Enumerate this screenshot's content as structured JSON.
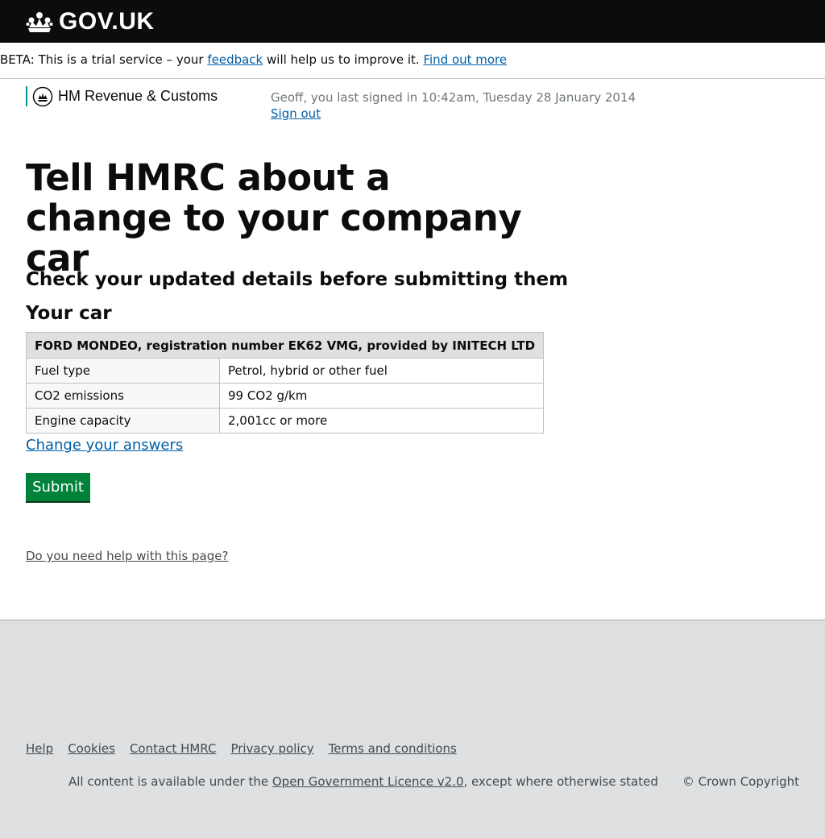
{
  "header": {
    "logo_text": "GOV.UK",
    "logo_icon": "crown-icon"
  },
  "beta_banner": {
    "text_before": "BETA: This is a trial service – your ",
    "feedback_link": "feedback",
    "text_middle": " will help us to improve it. ",
    "find_out_link": "Find out more"
  },
  "department": {
    "name": "HM Revenue & Customs",
    "icon": "crest-icon",
    "accent_color": "#009390"
  },
  "session": {
    "signed_in_text": "Geoff, you last signed in 10:42am, Tuesday 28 January 2014",
    "sign_out": "Sign out"
  },
  "main": {
    "title": "Tell HMRC about a change to your company car",
    "subtitle": "Check your updated details before submitting them",
    "section_heading": "Your car",
    "table": {
      "caption": "FORD MONDEO, registration number EK62 VMG, provided by INITECH LTD",
      "rows": [
        {
          "label": "Fuel type",
          "value": "Petrol, hybrid or other fuel"
        },
        {
          "label": "CO2 emissions",
          "value": "99 CO2 g/km"
        },
        {
          "label": "Engine capacity",
          "value": "2,001cc or more"
        }
      ]
    },
    "change_link": "Change your answers",
    "submit_label": "Submit",
    "help_link": "Do you need help with this page?"
  },
  "footer": {
    "links": [
      "Help",
      "Cookies",
      "Contact HMRC",
      "Privacy policy",
      "Terms and conditions"
    ],
    "licence_before": "All content is available under the ",
    "licence_link": "Open Government Licence v2.0",
    "licence_after": ", except where otherwise stated",
    "copyright": "© Crown Copyright"
  },
  "colors": {
    "header_bg": "#0b0c0c",
    "link": "#005ea5",
    "button": "#00823b",
    "footer_bg": "#dee0e2"
  }
}
